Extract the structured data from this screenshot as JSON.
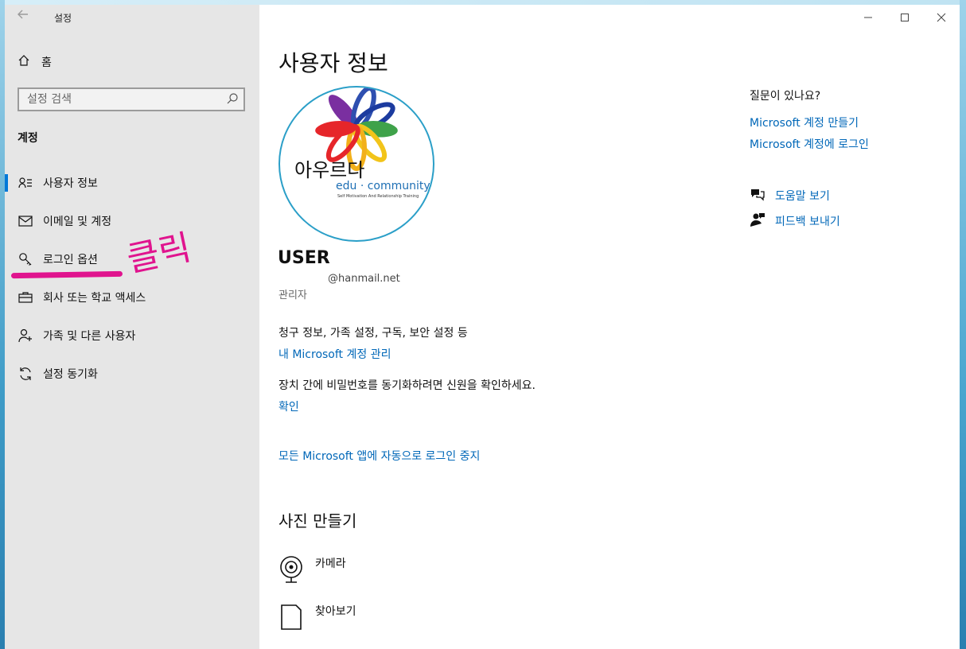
{
  "window": {
    "title": "설정"
  },
  "sidebar": {
    "home_label": "홈",
    "search_placeholder": "설정 검색",
    "section_title": "계정",
    "items": [
      {
        "label": "사용자 정보",
        "icon": "user-info-icon",
        "active": true
      },
      {
        "label": "이메일 및 계정",
        "icon": "mail-icon"
      },
      {
        "label": "로그인 옵션",
        "icon": "key-icon"
      },
      {
        "label": "회사 또는 학교 액세스",
        "icon": "briefcase-icon"
      },
      {
        "label": "가족 및 다른 사용자",
        "icon": "person-add-icon"
      },
      {
        "label": "설정 동기화",
        "icon": "sync-icon"
      }
    ]
  },
  "annotation": {
    "text": "클릭",
    "color": "#e0148e"
  },
  "main": {
    "title": "사용자 정보",
    "avatar": {
      "logo_text": "아우르다",
      "logo_sub": "edu · community",
      "logo_tagline": "Self Motivation And Relationship Training"
    },
    "user_name": "USER",
    "email": "@hanmail.net",
    "role": "관리자",
    "billing_text": "청구 정보, 가족 설정, 구독, 보안 설정 등",
    "manage_link": "내 Microsoft 계정 관리",
    "sync_text": "장치 간에 비밀번호를 동기화하려면 신원을 확인하세요.",
    "verify_link": "확인",
    "stop_signin_link": "모든 Microsoft 앱에 자동으로 로그인 중지",
    "photo_title": "사진 만들기",
    "camera_label": "카메라",
    "browse_label": "찾아보기"
  },
  "aside": {
    "question": "질문이 있나요?",
    "create_link": "Microsoft 계정 만들기",
    "login_link": "Microsoft 계정에 로그인",
    "help_link": "도움말 보기",
    "feedback_link": "피드백 보내기"
  },
  "colors": {
    "accent": "#0078d7",
    "link": "#0067b8",
    "sidebar_bg": "#e6e6e6",
    "avatar_ring": "#2b9fc8"
  }
}
